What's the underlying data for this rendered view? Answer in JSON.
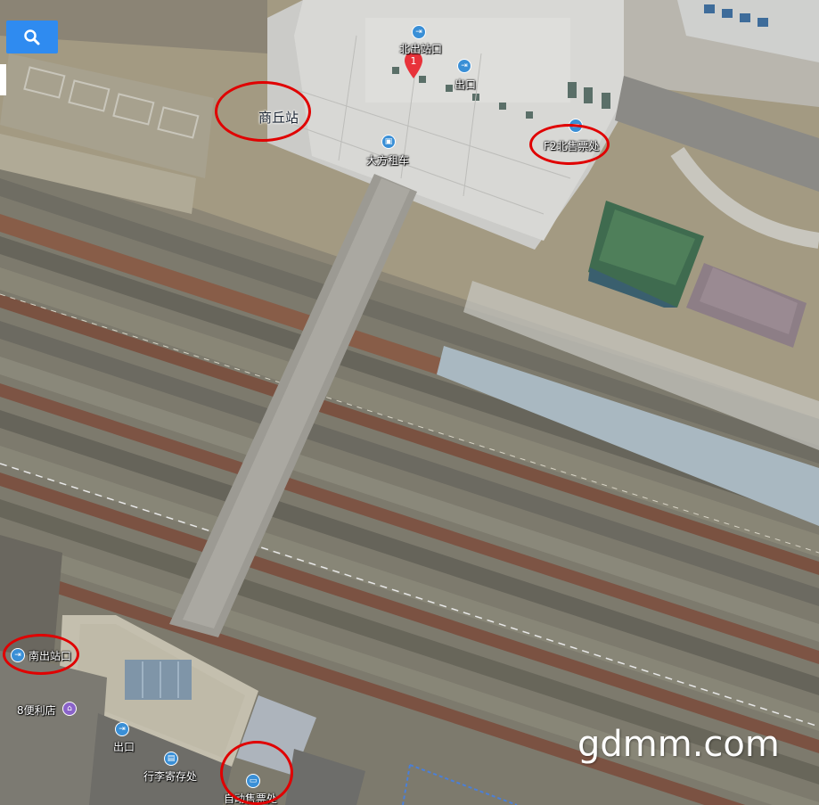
{
  "map": {
    "station_label": "商丘站",
    "pois": {
      "north_exit": "北出站口",
      "exit_north": "出口",
      "taxi": "大方租车",
      "ticket_north": "F2北售票处",
      "south_exit": "南出站口",
      "store": "8便利店",
      "exit_south": "出口",
      "luggage": "行李寄存处",
      "ticket_auto": "自动售票处"
    },
    "marker_number": "1"
  },
  "icons": {
    "search": "search-icon",
    "exit": "exit-icon",
    "taxi": "car-icon",
    "ticket": "ticket-icon",
    "store": "store-icon",
    "luggage": "luggage-icon",
    "marker": "map-pin-icon"
  },
  "watermark": "gdmm.com",
  "colors": {
    "highlight_circle": "#e00000",
    "search_button": "#2f8bf0",
    "poi_icon": "#3a8fd6",
    "store_icon": "#8a63c9",
    "marker": "#e8323a"
  }
}
